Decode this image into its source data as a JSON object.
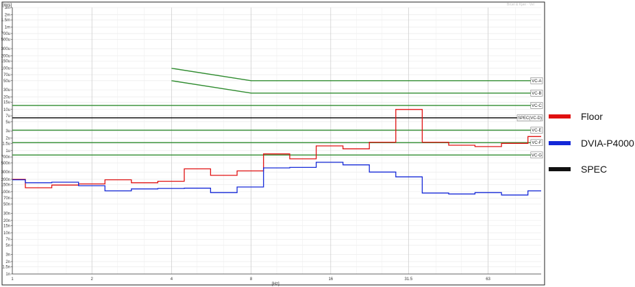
{
  "chart_data": {
    "type": "line",
    "y_unit_label": "[m/s]",
    "x_unit_label": "[Hz]",
    "watermark": "Brüel & Kjær · Vel",
    "xscale": "log",
    "yscale": "log",
    "xlim": [
      1,
      100
    ],
    "ylim": [
      1e-09,
      0.003
    ],
    "grid": true,
    "legend_position": "right",
    "x_ticks": [
      {
        "value": 1,
        "label": "1"
      },
      {
        "value": 2,
        "label": "2"
      },
      {
        "value": 4,
        "label": "4"
      },
      {
        "value": 8,
        "label": "8"
      },
      {
        "value": 16,
        "label": "16"
      },
      {
        "value": 31.5,
        "label": "31.5"
      },
      {
        "value": 63,
        "label": "63"
      }
    ],
    "x_minor": [
      1.25,
      1.6,
      2.5,
      3.15,
      5,
      6.3,
      10,
      12.5,
      20,
      25,
      40,
      50,
      80
    ],
    "y_ticks": [
      {
        "value": 0.003,
        "label": "3m"
      },
      {
        "value": 0.002,
        "label": "2m"
      },
      {
        "value": 0.0015,
        "label": "1.5m"
      },
      {
        "value": 0.001,
        "label": "1m"
      },
      {
        "value": 0.0007,
        "label": "700u"
      },
      {
        "value": 0.0005,
        "label": "500u"
      },
      {
        "value": 0.0003,
        "label": "300u"
      },
      {
        "value": 0.0002,
        "label": "200u"
      },
      {
        "value": 0.00015,
        "label": "150u"
      },
      {
        "value": 0.0001,
        "label": "100u"
      },
      {
        "value": 7e-05,
        "label": "70u"
      },
      {
        "value": 5e-05,
        "label": "50u"
      },
      {
        "value": 3e-05,
        "label": "30u"
      },
      {
        "value": 2e-05,
        "label": "20u"
      },
      {
        "value": 1.5e-05,
        "label": "15u"
      },
      {
        "value": 1e-05,
        "label": "10u"
      },
      {
        "value": 7e-06,
        "label": "7u"
      },
      {
        "value": 5e-06,
        "label": "5u"
      },
      {
        "value": 3e-06,
        "label": "3u"
      },
      {
        "value": 2e-06,
        "label": "2u"
      },
      {
        "value": 1.5e-06,
        "label": "1.5u"
      },
      {
        "value": 1e-06,
        "label": "1u"
      },
      {
        "value": 7e-07,
        "label": "700n"
      },
      {
        "value": 5e-07,
        "label": "500n"
      },
      {
        "value": 3e-07,
        "label": "300n"
      },
      {
        "value": 2e-07,
        "label": "200n"
      },
      {
        "value": 1.5e-07,
        "label": "150n"
      },
      {
        "value": 1e-07,
        "label": "100n"
      },
      {
        "value": 7e-08,
        "label": "70n"
      },
      {
        "value": 5e-08,
        "label": "50n"
      },
      {
        "value": 3e-08,
        "label": "30n"
      },
      {
        "value": 2e-08,
        "label": "20n"
      },
      {
        "value": 1.5e-08,
        "label": "15n"
      },
      {
        "value": 1e-08,
        "label": "10n"
      },
      {
        "value": 7e-09,
        "label": "7n"
      },
      {
        "value": 5e-09,
        "label": "5n"
      },
      {
        "value": 3e-09,
        "label": "3n"
      },
      {
        "value": 2e-09,
        "label": "2n"
      },
      {
        "value": 1.5e-09,
        "label": "1.5n"
      },
      {
        "value": 1e-09,
        "label": "1n"
      }
    ],
    "criteria": [
      {
        "label": "VC-A",
        "color": "#2e8b2e",
        "points": [
          [
            4,
            0.0001
          ],
          [
            8,
            5e-05
          ],
          [
            100,
            5e-05
          ]
        ]
      },
      {
        "label": "VC-B",
        "color": "#2e8b2e",
        "points": [
          [
            4,
            5e-05
          ],
          [
            8,
            2.5e-05
          ],
          [
            100,
            2.5e-05
          ]
        ]
      },
      {
        "label": "VC-C",
        "color": "#2e8b2e",
        "points": [
          [
            1,
            1.25e-05
          ],
          [
            100,
            1.25e-05
          ]
        ]
      },
      {
        "label": "SPEC(VC-D)",
        "color": "#111111",
        "points": [
          [
            1,
            6.25e-06
          ],
          [
            100,
            6.25e-06
          ]
        ]
      },
      {
        "label": "VC-E",
        "color": "#2e8b2e",
        "points": [
          [
            1,
            3.12e-06
          ],
          [
            100,
            3.12e-06
          ]
        ]
      },
      {
        "label": "VC-F",
        "color": "#2e8b2e",
        "points": [
          [
            1,
            1.56e-06
          ],
          [
            100,
            1.56e-06
          ]
        ]
      },
      {
        "label": "VC-G",
        "color": "#2e8b2e",
        "points": [
          [
            1,
            7.8e-07
          ],
          [
            100,
            7.8e-07
          ]
        ]
      }
    ],
    "series": [
      {
        "name": "Floor",
        "color": "#e01010",
        "steps": [
          {
            "x0": 1,
            "x1": 1.12,
            "y": 2e-07
          },
          {
            "x0": 1.12,
            "x1": 1.41,
            "y": 1.25e-07
          },
          {
            "x0": 1.41,
            "x1": 1.78,
            "y": 1.45e-07
          },
          {
            "x0": 1.78,
            "x1": 2.24,
            "y": 1.55e-07
          },
          {
            "x0": 2.24,
            "x1": 2.82,
            "y": 1.95e-07
          },
          {
            "x0": 2.82,
            "x1": 3.55,
            "y": 1.65e-07
          },
          {
            "x0": 3.55,
            "x1": 4.47,
            "y": 1.8e-07
          },
          {
            "x0": 4.47,
            "x1": 5.62,
            "y": 3.6e-07
          },
          {
            "x0": 5.62,
            "x1": 7.08,
            "y": 2.5e-07
          },
          {
            "x0": 7.08,
            "x1": 8.91,
            "y": 3.2e-07
          },
          {
            "x0": 8.91,
            "x1": 11.2,
            "y": 8.3e-07
          },
          {
            "x0": 11.2,
            "x1": 14.1,
            "y": 6.3e-07
          },
          {
            "x0": 14.1,
            "x1": 17.8,
            "y": 1.3e-06
          },
          {
            "x0": 17.8,
            "x1": 22.4,
            "y": 1.1e-06
          },
          {
            "x0": 22.4,
            "x1": 28.2,
            "y": 1.6e-06
          },
          {
            "x0": 28.2,
            "x1": 35.5,
            "y": 1e-05
          },
          {
            "x0": 35.5,
            "x1": 44.7,
            "y": 1.6e-06
          },
          {
            "x0": 44.7,
            "x1": 56.2,
            "y": 1.35e-06
          },
          {
            "x0": 56.2,
            "x1": 70.8,
            "y": 1.25e-06
          },
          {
            "x0": 70.8,
            "x1": 89.1,
            "y": 1.5e-06
          },
          {
            "x0": 89.1,
            "x1": 100,
            "y": 2.2e-06
          }
        ]
      },
      {
        "name": "DVIA-P4000",
        "color": "#1428d8",
        "steps": [
          {
            "x0": 1,
            "x1": 1.12,
            "y": 1.95e-07
          },
          {
            "x0": 1.12,
            "x1": 1.41,
            "y": 1.65e-07
          },
          {
            "x0": 1.41,
            "x1": 1.78,
            "y": 1.7e-07
          },
          {
            "x0": 1.78,
            "x1": 2.24,
            "y": 1.4e-07
          },
          {
            "x0": 2.24,
            "x1": 2.82,
            "y": 1.05e-07
          },
          {
            "x0": 2.82,
            "x1": 3.55,
            "y": 1.17e-07
          },
          {
            "x0": 3.55,
            "x1": 4.47,
            "y": 1.2e-07
          },
          {
            "x0": 4.47,
            "x1": 5.62,
            "y": 1.22e-07
          },
          {
            "x0": 5.62,
            "x1": 7.08,
            "y": 9.5e-08
          },
          {
            "x0": 7.08,
            "x1": 8.91,
            "y": 1.3e-07
          },
          {
            "x0": 8.91,
            "x1": 11.2,
            "y": 3.8e-07
          },
          {
            "x0": 11.2,
            "x1": 14.1,
            "y": 3.9e-07
          },
          {
            "x0": 14.1,
            "x1": 17.8,
            "y": 5.2e-07
          },
          {
            "x0": 17.8,
            "x1": 22.4,
            "y": 4.5e-07
          },
          {
            "x0": 22.4,
            "x1": 28.2,
            "y": 3e-07
          },
          {
            "x0": 28.2,
            "x1": 35.5,
            "y": 2.3e-07
          },
          {
            "x0": 35.5,
            "x1": 44.7,
            "y": 9.3e-08
          },
          {
            "x0": 44.7,
            "x1": 56.2,
            "y": 8.8e-08
          },
          {
            "x0": 56.2,
            "x1": 70.8,
            "y": 9.5e-08
          },
          {
            "x0": 70.8,
            "x1": 89.1,
            "y": 8.3e-08
          },
          {
            "x0": 89.1,
            "x1": 100,
            "y": 1.05e-07
          }
        ]
      },
      {
        "name": "SPEC",
        "color": "#111111",
        "steps": []
      }
    ]
  }
}
